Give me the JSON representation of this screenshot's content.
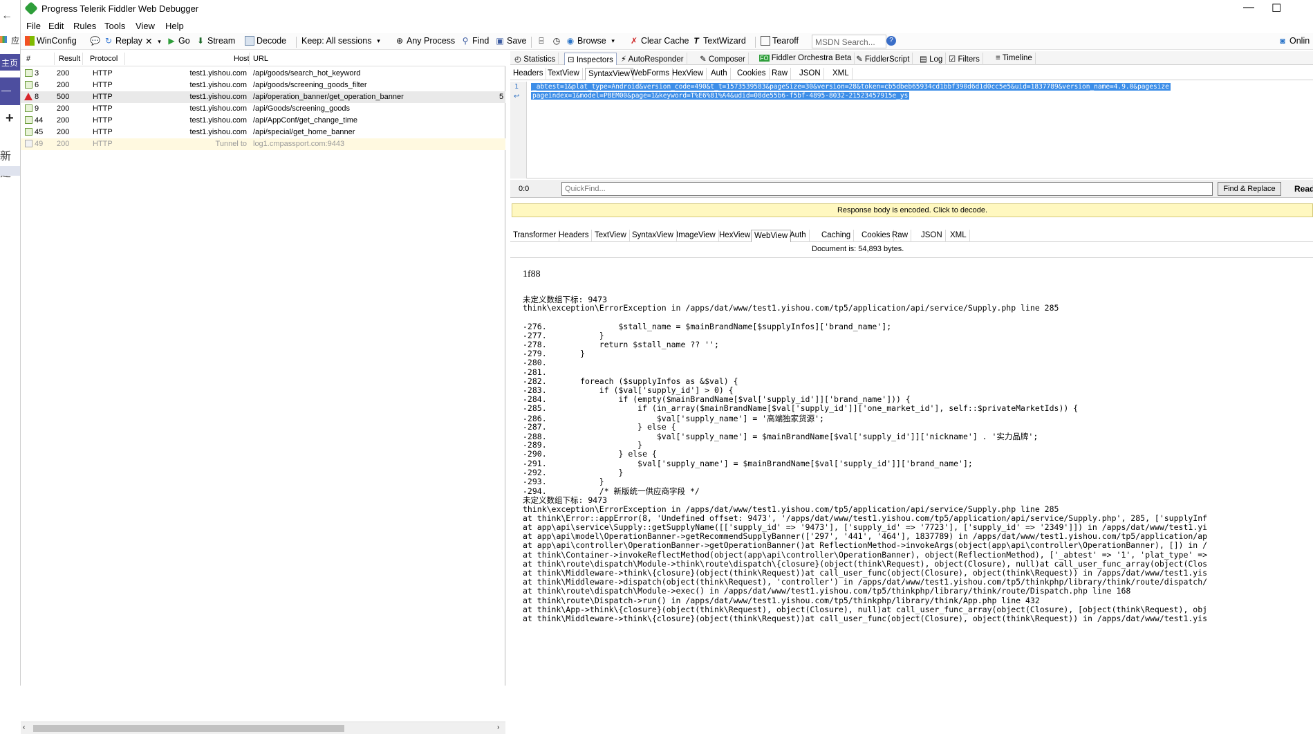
{
  "left_strip": {
    "apps_label": "应",
    "home_label": "主页",
    "home2_label": "—",
    "plus": "+",
    "new_label": "新建"
  },
  "window": {
    "title": "Progress Telerik Fiddler Web Debugger",
    "minimize": "—",
    "maximize": "☐"
  },
  "menu": [
    "File",
    "Edit",
    "Rules",
    "Tools",
    "View",
    "Help"
  ],
  "toolbar": {
    "winconfig": "WinConfig",
    "replay": "Replay",
    "remove": "✕",
    "go": "Go",
    "stream": "Stream",
    "decode": "Decode",
    "keep": "Keep: All sessions",
    "process": "Any Process",
    "find": "Find",
    "save": "Save",
    "browse": "Browse",
    "clear_cache": "Clear Cache",
    "textwizard": "TextWizard",
    "tearoff": "Tearoff",
    "msdn_placeholder": "MSDN Search...",
    "online": "Onlin"
  },
  "sessions": {
    "columns": [
      "#",
      "Result",
      "Protocol",
      "Host",
      "URL"
    ],
    "rows": [
      {
        "id": "3",
        "result": "200",
        "protocol": "HTTP",
        "host": "test1.yishou.com",
        "url": "/api/goods/search_hot_keyword",
        "kind": "ok"
      },
      {
        "id": "6",
        "result": "200",
        "protocol": "HTTP",
        "host": "test1.yishou.com",
        "url": "/api/goods/screening_goods_filter",
        "kind": "ok"
      },
      {
        "id": "8",
        "result": "500",
        "protocol": "HTTP",
        "host": "test1.yishou.com",
        "url": "/api/operation_banner/get_operation_banner",
        "kind": "error",
        "extra": "5"
      },
      {
        "id": "9",
        "result": "200",
        "protocol": "HTTP",
        "host": "test1.yishou.com",
        "url": "/api/Goods/screening_goods",
        "kind": "ok"
      },
      {
        "id": "44",
        "result": "200",
        "protocol": "HTTP",
        "host": "test1.yishou.com",
        "url": "/api/AppConf/get_change_time",
        "kind": "ok"
      },
      {
        "id": "45",
        "result": "200",
        "protocol": "HTTP",
        "host": "test1.yishou.com",
        "url": "/api/special/get_home_banner",
        "kind": "ok"
      },
      {
        "id": "49",
        "result": "200",
        "protocol": "HTTP",
        "host": "Tunnel to",
        "url": "log1.cmpassport.com:9443",
        "kind": "tunnel"
      }
    ]
  },
  "top_tabs": [
    "Statistics",
    "Inspectors",
    "AutoResponder",
    "Composer",
    "Fiddler Orchestra Beta",
    "FiddlerScript",
    "Log",
    "Filters",
    "Timeline"
  ],
  "request_tabs": [
    "Headers",
    "TextView",
    "SyntaxView",
    "WebForms",
    "HexView",
    "Auth",
    "Cookies",
    "Raw",
    "JSON",
    "XML"
  ],
  "request_body": {
    "line_no": "1",
    "wrap_marker": "↩",
    "line1": "_abtest=1&plat_type=Android&version_code=490&t_t=1573539583&pageSize=30&version=28&token=cb5dbeb65934cd1bbf390d6d1d0cc5e5&uid=1837789&version_name=4.9.0&pagesize",
    "line2": "pageindex=1&model=PBEM00&page=1&keyword=T%E6%81%A4&udid=08de55b6-f5bf-4895-8032-21523457915e_ys"
  },
  "quickfind": {
    "pos": "0:0",
    "placeholder": "QuickFind...",
    "button": "Find & Replace",
    "readonly": "Read"
  },
  "encoded_notice": "Response body is encoded. Click to decode.",
  "response_tabs": [
    "Transformer",
    "Headers",
    "TextView",
    "SyntaxView",
    "ImageView",
    "HexView",
    "WebView",
    "Auth",
    "Caching",
    "Cookies",
    "Raw",
    "JSON",
    "XML"
  ],
  "document_size": "Document is: 54,893 bytes.",
  "webview": {
    "chunk_size": "1f88",
    "lines": [
      "未定义数组下标: 9473",
      "think\\exception\\ErrorException in /apps/dat/www/test1.yishou.com/tp5/application/api/service/Supply.php line 285",
      "",
      "-276.               $stall_name = $mainBrandName[$supplyInfos]['brand_name'];",
      "-277.           }",
      "-278.           return $stall_name ?? '';",
      "-279.       }",
      "-280.",
      "-281.",
      "-282.       foreach ($supplyInfos as &$val) {",
      "-283.           if ($val['supply_id'] > 0) {",
      "-284.               if (empty($mainBrandName[$val['supply_id']]['brand_name'])) {",
      "-285.                   if (in_array($mainBrandName[$val['supply_id']]['one_market_id'], self::$privateMarketIds)) {",
      "-286.                       $val['supply_name'] = '高端独家货源';",
      "-287.                   } else {",
      "-288.                       $val['supply_name'] = $mainBrandName[$val['supply_id']]['nickname'] . '实力品牌';",
      "-289.                   }",
      "-290.               } else {",
      "-291.                   $val['supply_name'] = $mainBrandName[$val['supply_id']]['brand_name'];",
      "-292.               }",
      "-293.           }",
      "-294.           /* 新版统一供应商字段 */",
      "未定义数组下标: 9473",
      "think\\exception\\ErrorException in /apps/dat/www/test1.yishou.com/tp5/application/api/service/Supply.php line 285",
      "at think\\Error::appError(8, 'Undefined offset: 9473', '/apps/dat/www/test1.yishou.com/tp5/application/api/service/Supply.php', 285, ['supplyInf",
      "at app\\api\\service\\Supply::getSupplyName([['supply_id' => '9473'], ['supply_id' => '7723'], ['supply_id' => '2349']]) in /apps/dat/www/test1.yi",
      "at app\\api\\model\\OperationBanner->getRecommendSupplyBanner(['297', '441', '464'], 1837789) in /apps/dat/www/test1.yishou.com/tp5/application/ap",
      "at app\\api\\controller\\OperationBanner->getOperationBanner()at ReflectionMethod->invokeArgs(object(app\\api\\controller\\OperationBanner), []) in /",
      "at think\\Container->invokeReflectMethod(object(app\\api\\controller\\OperationBanner), object(ReflectionMethod), ['_abtest' => '1', 'plat_type' =>",
      "at think\\route\\dispatch\\Module->think\\route\\dispatch\\{closure}(object(think\\Request), object(Closure), null)at call_user_func_array(object(Clos",
      "at think\\Middleware->think\\{closure}(object(think\\Request))at call_user_func(object(Closure), object(think\\Request)) in /apps/dat/www/test1.yis",
      "at think\\Middleware->dispatch(object(think\\Request), 'controller') in /apps/dat/www/test1.yishou.com/tp5/thinkphp/library/think/route/dispatch/",
      "at think\\route\\dispatch\\Module->exec() in /apps/dat/www/test1.yishou.com/tp5/thinkphp/library/think/route/Dispatch.php line 168",
      "at think\\route\\Dispatch->run() in /apps/dat/www/test1.yishou.com/tp5/thinkphp/library/think/App.php line 432",
      "at think\\App->think\\{closure}(object(think\\Request), object(Closure), null)at call_user_func_array(object(Closure), [object(think\\Request), obj",
      "at think\\Middleware->think\\{closure}(object(think\\Request))at call_user_func(object(Closure), object(think\\Request)) in /apps/dat/www/test1.yis"
    ]
  }
}
